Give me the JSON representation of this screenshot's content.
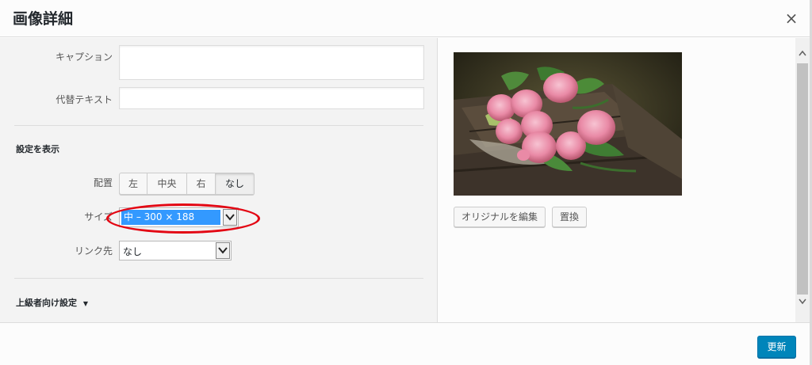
{
  "dialog": {
    "title": "画像詳細",
    "close_glyph": "×"
  },
  "fields": {
    "caption_label": "キャプション",
    "caption_value": "",
    "alt_label": "代替テキスト",
    "alt_value": ""
  },
  "display_settings": {
    "heading": "設定を表示",
    "align_label": "配置",
    "align_options": [
      "左",
      "中央",
      "右",
      "なし"
    ],
    "align_selected": "なし",
    "size_label": "サイズ",
    "size_value": "中 – 300 × 188",
    "link_label": "リンク先",
    "link_value": "なし"
  },
  "advanced": {
    "label": "上級者向け設定",
    "arrow": "▼"
  },
  "preview": {
    "edit_original_label": "オリジナルを編集",
    "replace_label": "置換"
  },
  "footer": {
    "update_label": "更新"
  },
  "colors": {
    "primary": "#0085ba",
    "highlight": "#e30613",
    "selection": "#3399ff"
  },
  "icons": {
    "close": "close-icon",
    "dropdown": "chevron-down-icon",
    "scroll_up": "scroll-up-icon",
    "scroll_down": "scroll-down-icon"
  }
}
